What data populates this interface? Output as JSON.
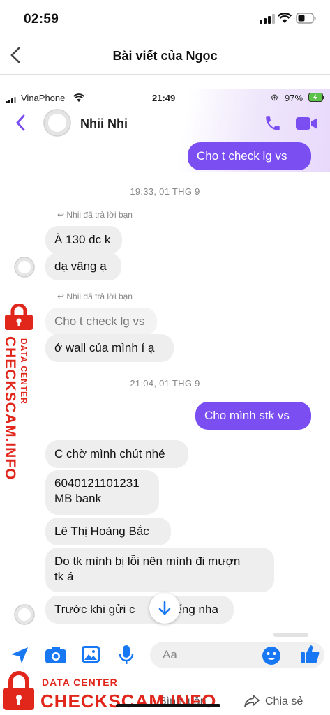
{
  "outer_status": {
    "time": "02:59"
  },
  "outer_header": {
    "title": "Bài viết của Ngọc"
  },
  "inner_status": {
    "carrier": "VinaPhone",
    "time": "21:49",
    "battery": "97%"
  },
  "chat_header": {
    "name": "Nhii Nhi"
  },
  "messages": {
    "m1": "Cho t check lg vs",
    "ts1": "19:33, 01 THG 9",
    "reply1": "Nhii đã trả lời bạn",
    "m2": "À 130 đc k",
    "m3": "dạ vâng ạ",
    "reply2": "Nhii đã trả lời bạn",
    "m4_quoted": "Cho t check lg vs",
    "m5": "ở wall của mình í ạ",
    "ts2": "21:04, 01 THG 9",
    "m6": "Cho mình stk vs",
    "m7": "C chờ mình chút nhé",
    "m8_account": "6040121101231",
    "m8_bank": "MB bank",
    "m9": "Lê Thị Hoàng Bắc",
    "m10_line1": "Do tk mình bị lỗi nên mình đi mượn",
    "m10_line2": "tk á",
    "m11_left": "Trước khi gửi c",
    "m11_right": "ếng nha"
  },
  "composer": {
    "placeholder": "Aa"
  },
  "watermark": {
    "side_label": "DATA CENTER",
    "side_brand": "CHECKSCAM.INFO",
    "bottom_label": "DATA CENTER",
    "bottom_brand": "CHECKSCAM.INFO"
  },
  "footer": {
    "share": "Chia sẻ",
    "partial_left": "Bình luận"
  },
  "colors": {
    "accent": "#7b4ef2",
    "watermark": "#e1261c",
    "icon_blue": "#1877f2"
  }
}
